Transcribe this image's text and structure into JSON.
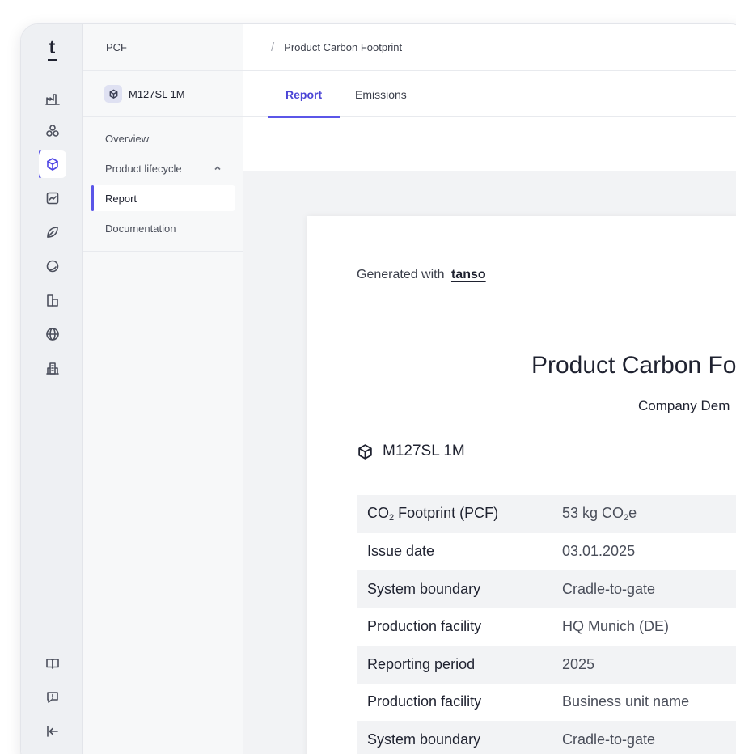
{
  "brand": {
    "logo": "t"
  },
  "rail": {
    "items": [
      {
        "icon": "factory-icon"
      },
      {
        "icon": "molecule-icon"
      },
      {
        "icon": "cube-icon",
        "active": true
      },
      {
        "icon": "chart-icon"
      },
      {
        "icon": "leaf-icon"
      },
      {
        "icon": "globe-orbit-icon"
      },
      {
        "icon": "buildings-icon"
      },
      {
        "icon": "world-icon"
      },
      {
        "icon": "office-icon"
      }
    ],
    "bottom": [
      {
        "icon": "book-icon"
      },
      {
        "icon": "feedback-icon"
      },
      {
        "icon": "collapse-icon"
      }
    ]
  },
  "sidebar": {
    "header": "PCF",
    "product": "M127SL 1M",
    "nav": [
      {
        "label": "Overview"
      },
      {
        "label": "Product lifecycle"
      },
      {
        "label": "Report"
      },
      {
        "label": "Documentation"
      }
    ]
  },
  "topbar": {
    "slash": "/",
    "breadcrumb": "Product Carbon Footprint"
  },
  "tabs": [
    {
      "label": "Report"
    },
    {
      "label": "Emissions"
    }
  ],
  "document": {
    "generated_with": "Generated with",
    "generator": "tanso",
    "title": "Product Carbon Fo",
    "subtitle": "Company Dem",
    "product": "M127SL 1M",
    "facts": [
      {
        "label_pre": "CO",
        "label_sub": "2",
        "label_post": " Footprint (PCF)",
        "value_pre": "53 kg CO",
        "value_sub": "2",
        "value_post": "e"
      },
      {
        "label": "Issue date",
        "value": "03.01.2025"
      },
      {
        "label": "System boundary",
        "value": "Cradle-to-gate"
      },
      {
        "label": "Production facility",
        "value": "HQ Munich (DE)"
      },
      {
        "label": "Reporting period",
        "value": "2025"
      },
      {
        "label": "Production facility",
        "value": "Business unit name"
      },
      {
        "label": "System boundary",
        "value": "Cradle-to-gate"
      }
    ]
  },
  "colors": {
    "accent": "#5b56e8",
    "rail_bg": "#eef0f3",
    "sidebar_bg": "#f7f8f9",
    "canvas_bg": "#f2f3f5"
  }
}
